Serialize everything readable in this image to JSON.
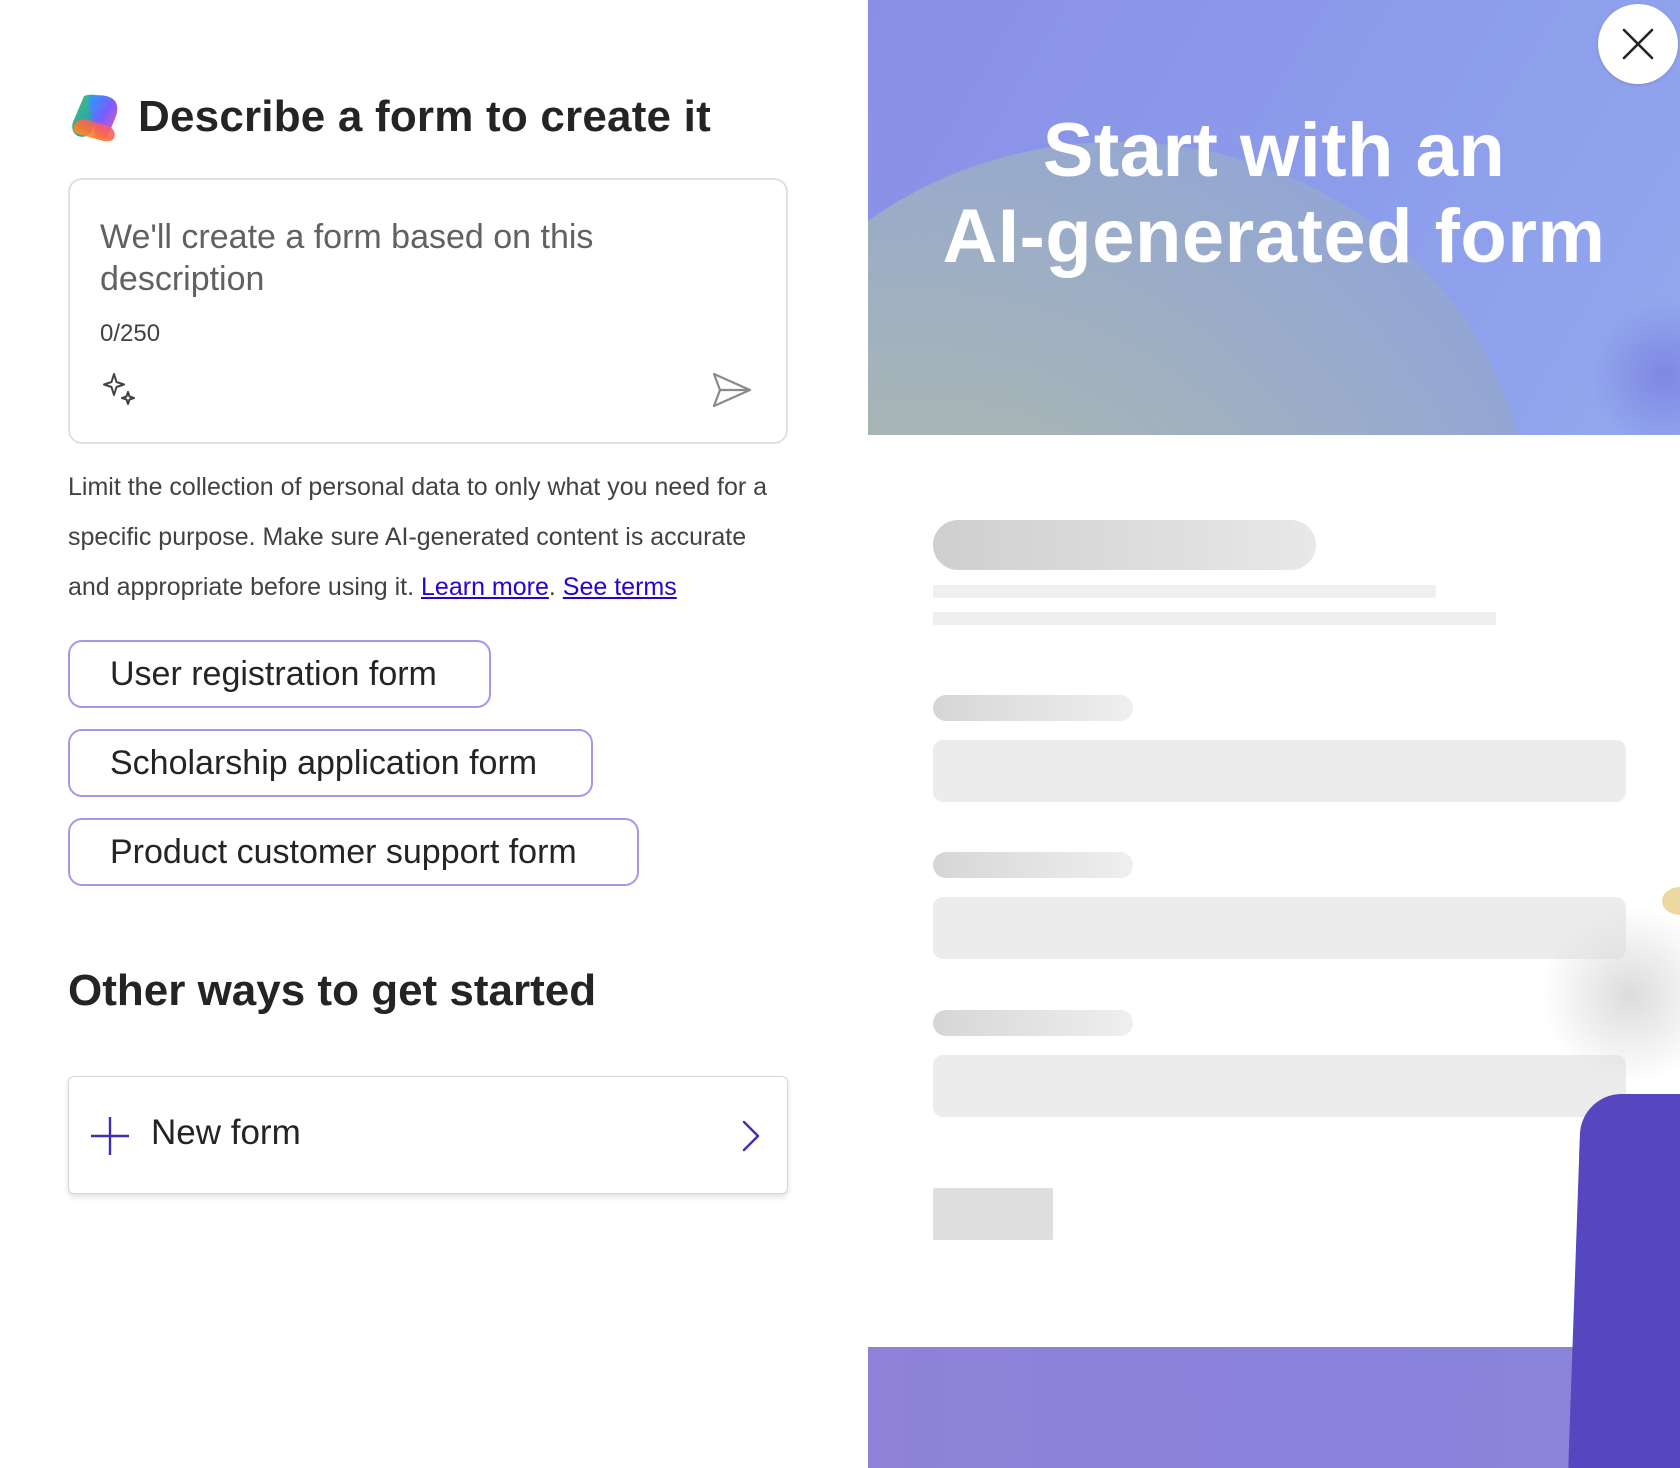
{
  "header": {
    "title": "Describe a form to create it"
  },
  "prompt": {
    "placeholder": "We'll create a form based on this description",
    "char_count": "0/250"
  },
  "disclaimer": {
    "text": "Limit the collection of personal data to only what you need for a specific purpose. Make sure AI-generated content is accurate and appropriate before using it.",
    "learn_more": "Learn more",
    "separator": ".",
    "see_terms": "See terms"
  },
  "suggestions": [
    {
      "label": "User registration form"
    },
    {
      "label": "Scholarship application form"
    },
    {
      "label": "Product customer support form"
    }
  ],
  "other_ways": {
    "title": "Other ways to get started",
    "new_form_label": "New form"
  },
  "hero": {
    "line1": "Start with an",
    "line2": "AI-generated form"
  },
  "icons": {
    "logo": "copilot-icon",
    "sparkle": "sparkle-icon",
    "send": "send-icon",
    "plus": "plus-icon",
    "chevron": "chevron-right-icon",
    "close": "close-icon"
  },
  "colors": {
    "accent": "#5646c0",
    "chip_border": "#a797ea",
    "link": "#2b00d4",
    "hero_bg": "#8c9ceb"
  }
}
